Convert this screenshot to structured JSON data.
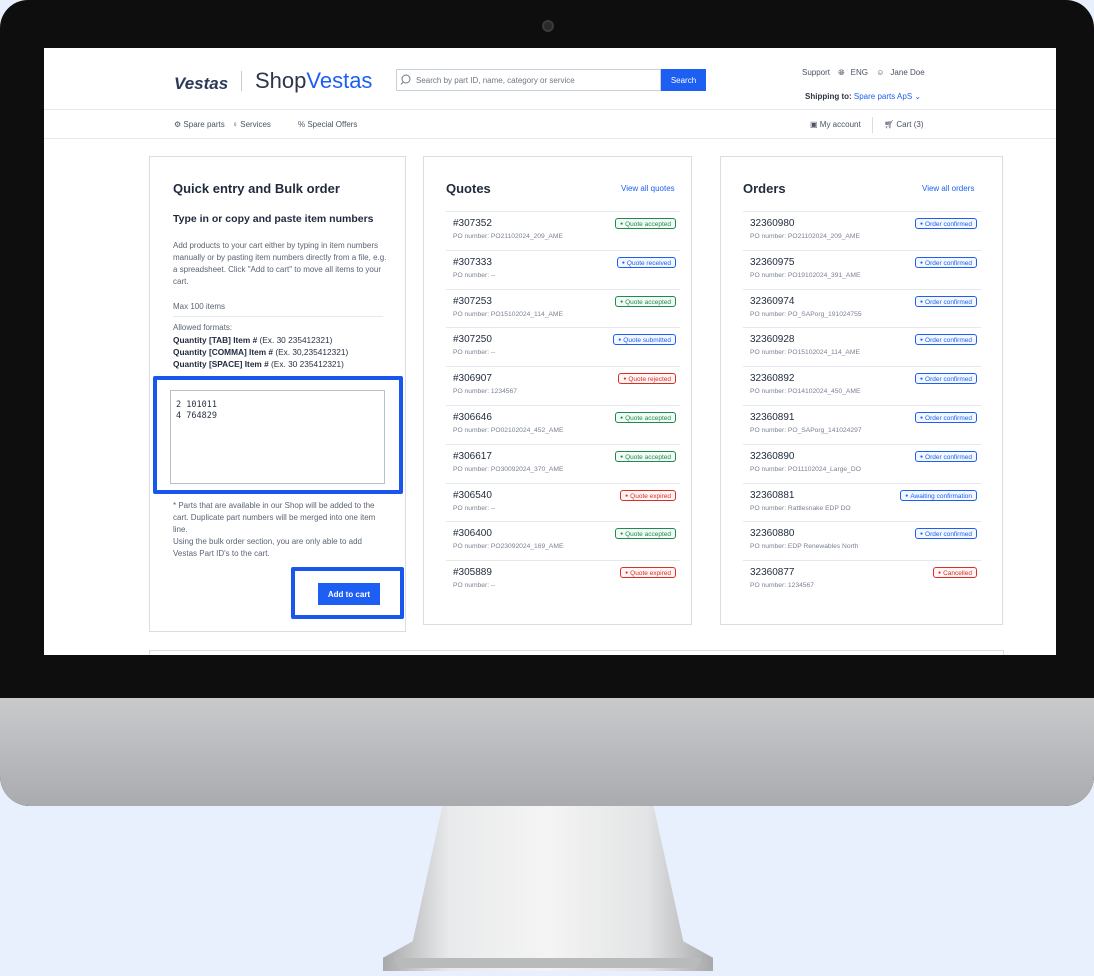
{
  "header": {
    "brand": "Vestas",
    "shop_prefix": "Shop",
    "shop_suffix": "Vestas",
    "search_placeholder": "Search by part ID, name, category or service",
    "search_button": "Search",
    "support": "Support",
    "language": "ENG",
    "user": "Jane Doe",
    "shipping_label": "Shipping to:",
    "shipping_value": "Spare parts ApS"
  },
  "nav": {
    "spare_parts": "Spare parts",
    "services": "Services",
    "special_offers": "% Special Offers",
    "my_account": "My account",
    "cart": "Cart (3)"
  },
  "quick_entry": {
    "title": "Quick entry and Bulk order",
    "subtitle": "Type in or copy and paste item numbers",
    "description": "Add products to your cart either by typing in item numbers manually or by pasting item numbers directly from a file, e.g. a spreadsheet. Click \"Add to cart\" to move all items to your cart.",
    "max_items": "Max 100 items",
    "formats_title": "Allowed formats:",
    "formats": [
      {
        "bold": "Quantity [TAB] Item #",
        "example": " (Ex. 30 235412321)"
      },
      {
        "bold": "Quantity [COMMA] Item #",
        "example": " (Ex. 30,235412321)"
      },
      {
        "bold": "Quantity [SPACE] Item #",
        "example": " (Ex. 30 235412321)"
      }
    ],
    "textarea_value": "2 101011\n4 764829",
    "note": "* Parts that are available in our Shop will be added to the cart. Duplicate part numbers will be merged into one item line.\nUsing the bulk order section, you are only able to add Vestas Part ID's to the cart.",
    "add_button": "Add to cart"
  },
  "quotes": {
    "title": "Quotes",
    "view_all": "View all quotes",
    "items": [
      {
        "number": "#307352",
        "po": "PO number: PO21102024_209_AME",
        "status": "Quote accepted",
        "type": "accepted"
      },
      {
        "number": "#307333",
        "po": "PO number: --",
        "status": "Quote received",
        "type": "received"
      },
      {
        "number": "#307253",
        "po": "PO number: PO15102024_114_AME",
        "status": "Quote accepted",
        "type": "accepted"
      },
      {
        "number": "#307250",
        "po": "PO number: --",
        "status": "Quote submitted",
        "type": "submitted"
      },
      {
        "number": "#306907",
        "po": "PO number: 1234567",
        "status": "Quote rejected",
        "type": "rejected"
      },
      {
        "number": "#306646",
        "po": "PO number: PO02102024_452_AME",
        "status": "Quote accepted",
        "type": "accepted"
      },
      {
        "number": "#306617",
        "po": "PO number: PO30092024_370_AME",
        "status": "Quote accepted",
        "type": "accepted"
      },
      {
        "number": "#306540",
        "po": "PO number: --",
        "status": "Quote expired",
        "type": "expired"
      },
      {
        "number": "#306400",
        "po": "PO number: PO23092024_169_AME",
        "status": "Quote accepted",
        "type": "accepted"
      },
      {
        "number": "#305889",
        "po": "PO number: --",
        "status": "Quote expired",
        "type": "expired"
      }
    ]
  },
  "orders": {
    "title": "Orders",
    "view_all": "View all orders",
    "items": [
      {
        "number": "32360980",
        "po": "PO number: PO21102024_209_AME",
        "status": "Order confirmed",
        "type": "confirmed"
      },
      {
        "number": "32360975",
        "po": "PO number: PO19102024_391_AME",
        "status": "Order confirmed",
        "type": "confirmed"
      },
      {
        "number": "32360974",
        "po": "PO number: PO_SAPorg_191024755",
        "status": "Order confirmed",
        "type": "confirmed"
      },
      {
        "number": "32360928",
        "po": "PO number: PO15102024_114_AME",
        "status": "Order confirmed",
        "type": "confirmed"
      },
      {
        "number": "32360892",
        "po": "PO number: PO14102024_450_AME",
        "status": "Order confirmed",
        "type": "confirmed"
      },
      {
        "number": "32360891",
        "po": "PO number: PO_SAPorg_141024297",
        "status": "Order confirmed",
        "type": "confirmed"
      },
      {
        "number": "32360890",
        "po": "PO number: PO11102024_Large_DO",
        "status": "Order confirmed",
        "type": "confirmed"
      },
      {
        "number": "32360881",
        "po": "PO number: Rattlesnake EDP DO",
        "status": "Awaiting confirmation",
        "type": "awaiting"
      },
      {
        "number": "32360880",
        "po": "PO number: EDP Renewables North",
        "status": "Order confirmed",
        "type": "confirmed"
      },
      {
        "number": "32360877",
        "po": "PO number: 1234567",
        "status": "Cancelled",
        "type": "cancelled"
      }
    ]
  }
}
